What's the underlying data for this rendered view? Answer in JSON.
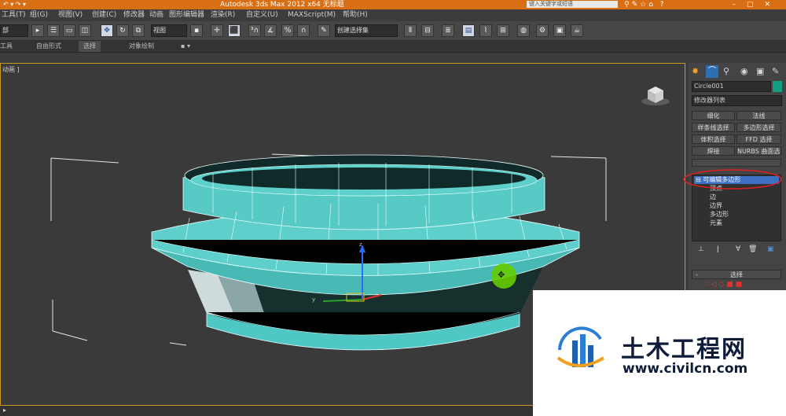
{
  "titlebar": {
    "title": "Autodesk 3ds Max  2012 x64      无标题",
    "search_placeholder": "键入关键字或短语",
    "colors": {
      "bar": "#d86f14"
    }
  },
  "menu": [
    "工具(T)",
    "组(G)",
    "视图(V)",
    "创建(C)",
    "修改器",
    "动画",
    "图形编辑器",
    "渲染(R)",
    "自定义(U)",
    "MAXScript(M)",
    "帮助(H)"
  ],
  "toolbar": {
    "filter_combo": "部",
    "view_combo": "视图",
    "selection_set_combo": "创建选择集"
  },
  "ribbon": {
    "tabs": [
      "工具",
      "自由形式",
      "选择",
      "对象绘制"
    ]
  },
  "viewport": {
    "label": "动画 ]",
    "pivot_cursor": "✥"
  },
  "panel": {
    "object_name": "Circle001",
    "modifier_list": "修改器列表",
    "modifier_buttons": [
      "细化",
      "法线",
      "样条线选择",
      "多边形选择",
      "体积选择",
      "FFD 选择",
      "焊接",
      "NURBS 曲面选择"
    ],
    "stack_items": [
      "可编辑多边形",
      "顶点",
      "边",
      "边界",
      "多边形",
      "元素"
    ],
    "selection_rollout": "选择",
    "colors": {
      "object_swatch": "#14a080",
      "stack_selected": "#3d6fc2"
    }
  },
  "watermark": {
    "title": "土木工程网",
    "url": "www.civilcn.com"
  }
}
